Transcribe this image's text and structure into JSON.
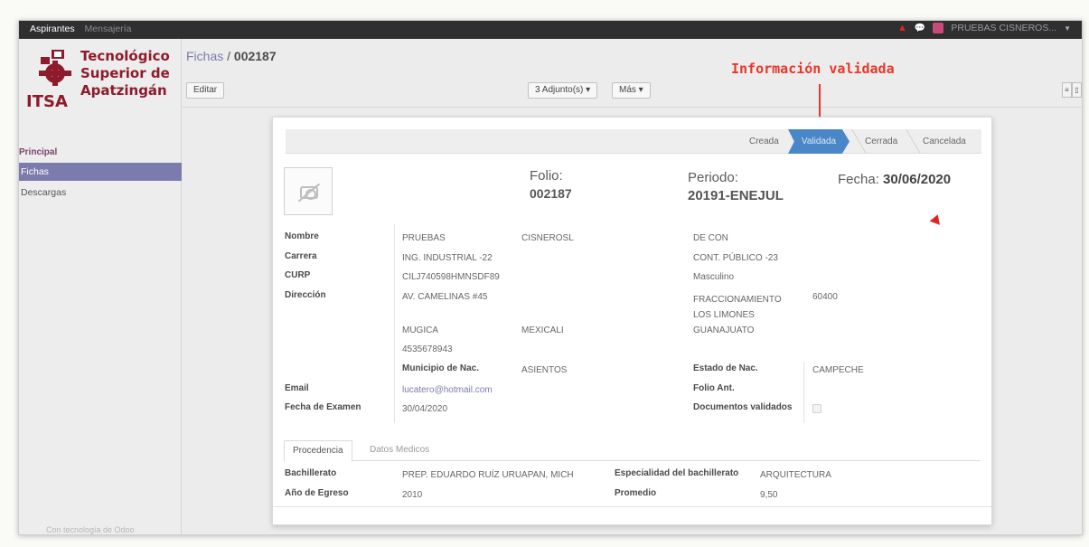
{
  "topbar": {
    "menu": [
      "Aspirantes",
      "Mensajería"
    ],
    "user": "PRUEBAS CISNEROS...",
    "alert_icon": "alert-triangle-icon",
    "chat_icon": "chat-icon"
  },
  "logo": {
    "line1": "Tecnológico",
    "line2": "Superior de",
    "line3": "Apatzingán",
    "acronym": "ITSA"
  },
  "sidebar": {
    "section": "Principal",
    "items": [
      "Fichas",
      "Descargas"
    ],
    "powered": "Con tecnología de Odoo"
  },
  "header": {
    "breadcrumb_parent": "Fichas",
    "breadcrumb_sep": " / ",
    "breadcrumb_current": "002187",
    "edit_label": "Editar",
    "attachments_label": "3 Adjunto(s) ▾",
    "more_label": "Más ▾"
  },
  "annotation": {
    "text": "Información validada",
    "color": "#e8362a"
  },
  "statusbar": {
    "stages": [
      "Creada",
      "Validada",
      "Cerrada",
      "Cancelada"
    ],
    "active": "Validada"
  },
  "record": {
    "folio_label": "Folio:",
    "folio": "002187",
    "periodo_label": "Periodo:",
    "periodo": "20191-ENEJUL",
    "fecha_label": "Fecha:",
    "fecha": "30/06/2020",
    "labels": {
      "nombre": "Nombre",
      "carrera": "Carrera",
      "curp": "CURP",
      "direccion": "Dirección",
      "municipio_nac": "Municipio de Nac.",
      "estado_nac": "Estado de Nac.",
      "email": "Email",
      "folio_ant": "Folio Ant.",
      "fecha_examen": "Fecha de Examen",
      "documentos": "Documentos validados"
    },
    "values": {
      "nombre1": "PRUEBAS",
      "nombre2": "CISNEROSL",
      "nombre3": "DE CON",
      "carrera1": "ING. INDUSTRIAL -22",
      "carrera2": "CONT. PÚBLICO -23",
      "curp": "CILJ740598HMNSDF89",
      "sexo": "Masculino",
      "calle": "AV. CAMELINAS #45",
      "colonia": "FRACCIONAMIENTO LOS LIMONES",
      "cp": "60400",
      "municipio": "MUGICA",
      "ciudad": "MEXICALI",
      "estado": "GUANAJUATO",
      "telefono": "4535678943",
      "municipio_nac": "ASIENTOS",
      "estado_nac": "CAMPECHE",
      "email": "lucatero@hotmail.com",
      "fecha_examen": "30/04/2020"
    }
  },
  "tabs": [
    "Procedencia",
    "Datos Medicos"
  ],
  "procedencia": {
    "bachillerato_label": "Bachillerato",
    "bachillerato": "PREP. EDUARDO RUÍZ URUAPAN, MICH",
    "especialidad_label": "Especialidad del bachillerato",
    "especialidad": "ARQUITECTURA",
    "egreso_label": "Año de Egreso",
    "egreso": "2010",
    "promedio_label": "Promedio",
    "promedio": "9,50"
  }
}
